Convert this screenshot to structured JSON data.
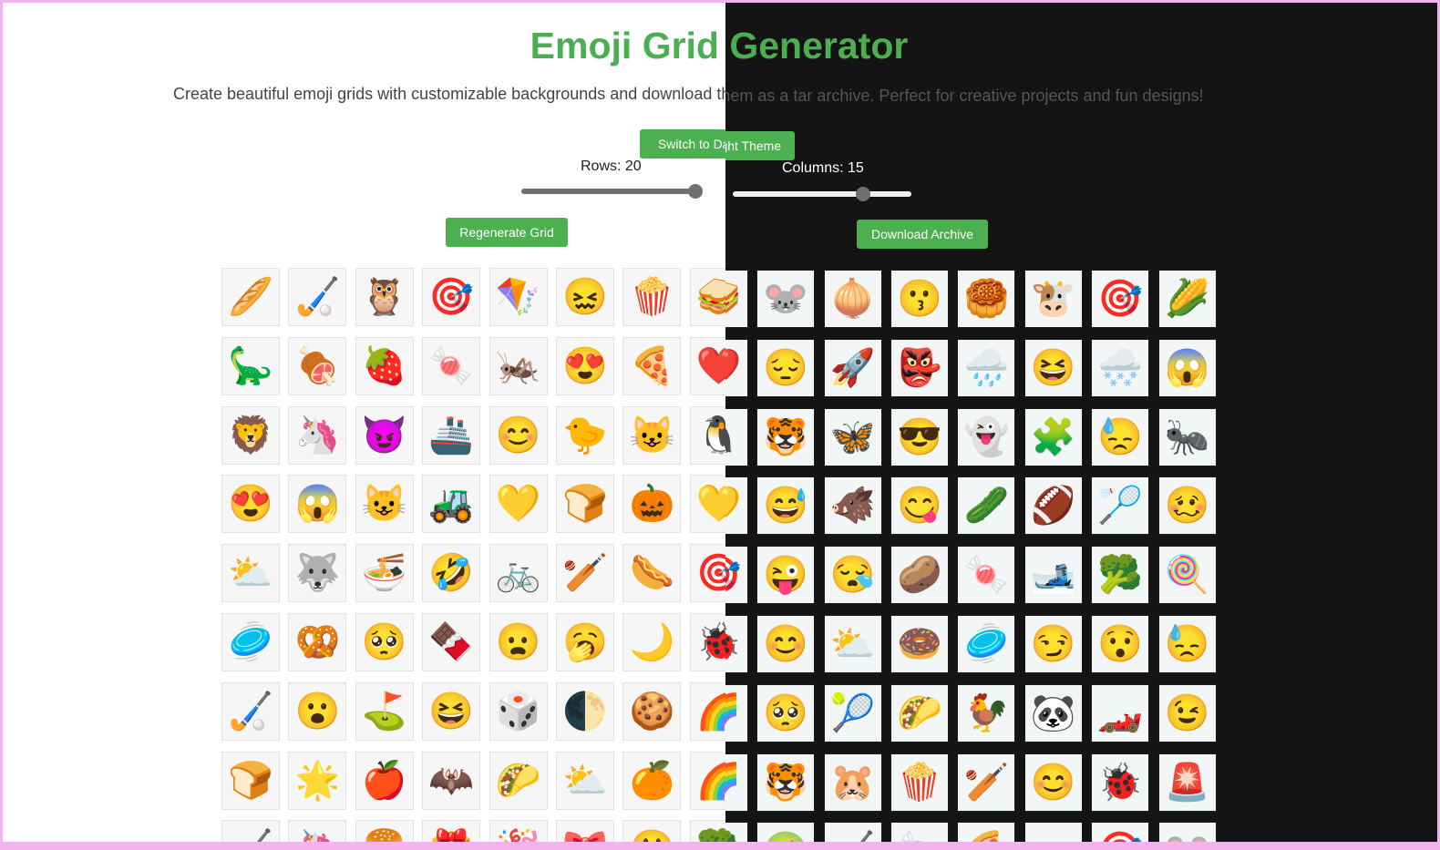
{
  "header": {
    "title": "Emoji Grid Generator",
    "subtitle": "Create beautiful emoji grids with customizable backgrounds and download them as a tar archive. Perfect for creative projects and fun designs!"
  },
  "theme_toggle": {
    "label_light": "Switch to Dark Theme",
    "label_dark": "Switch to Light Theme"
  },
  "controls": {
    "rows_label": "Rows: 20",
    "rows_value": 20,
    "columns_label": "Columns: 15",
    "columns_value": 15,
    "regenerate_label": "Regenerate Grid",
    "download_label": "Download Archive"
  },
  "colors": {
    "accent": "#4caf50",
    "dark_bg": "#141414",
    "frame": "#f4b2ee"
  },
  "grid": [
    [
      "🥖",
      "🏑",
      "🦉",
      "🎯",
      "🪁",
      "😖",
      "🍿",
      "🥪",
      "🐭",
      "🧅",
      "😗",
      "🥮",
      "🐮",
      "🎯",
      "🌽"
    ],
    [
      "🦕",
      "🍖",
      "🍓",
      "🍬",
      "🦗",
      "😍",
      "🍕",
      "❤️",
      "😔",
      "🚀",
      "👺",
      "🌧️",
      "😆",
      "🌨️",
      "😱"
    ],
    [
      "🦁",
      "🦄",
      "😈",
      "🚢",
      "😊",
      "🐤",
      "😺",
      "🐧",
      "🐯",
      "🦋",
      "😎",
      "👻",
      "🧩",
      "😓",
      "🐜"
    ],
    [
      "😍",
      "😱",
      "😺",
      "🚜",
      "💛",
      "🍞",
      "🎃",
      "💛",
      "😅",
      "🐗",
      "😋",
      "🥒",
      "🏈",
      "🏸",
      "🥴"
    ],
    [
      "⛅",
      "🐺",
      "🍜",
      "🤣",
      "🚲",
      "🏏",
      "🌭",
      "🎯",
      "😜",
      "😪",
      "🥔",
      "🍬",
      "🎿",
      "🥦",
      "🍭"
    ],
    [
      "🥏",
      "🥨",
      "🥺",
      "🍫",
      "😦",
      "🥱",
      "🌙",
      "🐞",
      "😊",
      "⛅",
      "🍩",
      "🥏",
      "😏",
      "😯",
      "😓"
    ],
    [
      "🏑",
      "😮",
      "⛳",
      "😆",
      "🎲",
      "🌓",
      "🍪",
      "🌈",
      "🥺",
      "🎾",
      "🌮",
      "🐓",
      "🐼",
      "🏎️",
      "😉"
    ],
    [
      "🍞",
      "🌟",
      "🍎",
      "🦇",
      "🌮",
      "⛅",
      "🍊",
      "🌈",
      "🐯",
      "🐹",
      "🍿",
      "🏏",
      "😊",
      "🐞",
      "🚨"
    ],
    [
      "🏑",
      "🦄",
      "🍔",
      "🎁",
      "🎉",
      "🎀",
      "😃",
      "🥦",
      "🤢",
      "🏑",
      "🍬",
      "🍕",
      "🚗",
      "🎯",
      "🐭"
    ]
  ]
}
